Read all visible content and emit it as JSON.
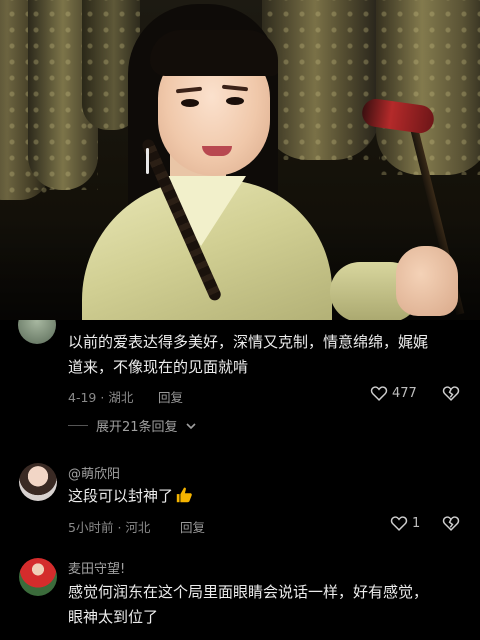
{
  "video": {
    "scene": "drama-still"
  },
  "comments": [
    {
      "username": "",
      "text_line1": "以前的爱表达得多美好，深情又克制，情意绵绵，娓娓",
      "text_line2": "道来，不像现在的见面就啃",
      "date": "4-19",
      "location": "湖北",
      "reply_label": "回复",
      "likes": "477",
      "expand_label": "展开21条回复"
    },
    {
      "username": "@萌欣阳",
      "text": "这段可以封神了",
      "time": "5小时前",
      "location": "河北",
      "reply_label": "回复",
      "likes": "1"
    },
    {
      "username": "麦田守望!",
      "text_line1": "感觉何润东在这个局里面眼睛会说话一样，好有感觉，",
      "text_line2": "眼神太到位了"
    }
  ],
  "colors": {
    "background": "#000000",
    "text": "#ececec",
    "meta": "#8a8a8a",
    "thumb_emoji": "#f5b400"
  },
  "icons": [
    "heart-icon",
    "broken-heart-icon",
    "chevron-down-icon",
    "thumbs-up-emoji"
  ]
}
